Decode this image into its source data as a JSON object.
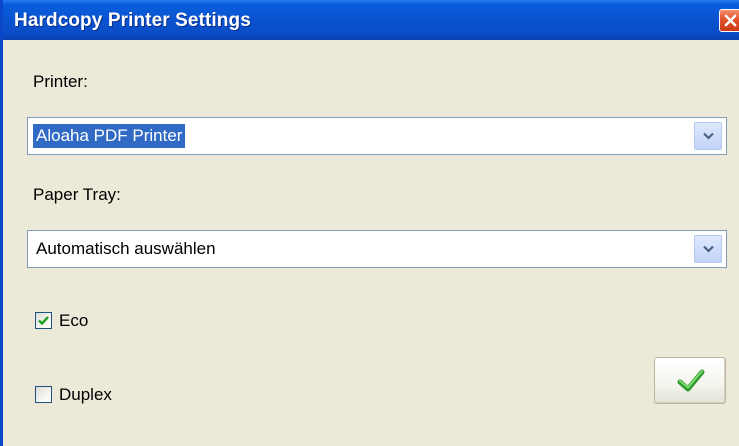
{
  "window": {
    "title": "Hardcopy Printer Settings",
    "close_icon": "close-icon"
  },
  "printer": {
    "label": "Printer:",
    "selected_value": "Aloaha PDF Printer",
    "icon": "chevron-down-icon"
  },
  "paper_tray": {
    "label": "Paper Tray:",
    "selected_value": "Automatisch auswählen",
    "icon": "chevron-down-icon"
  },
  "eco": {
    "label": "Eco",
    "checked": true
  },
  "duplex": {
    "label": "Duplex",
    "checked": false
  },
  "ok_button": {
    "icon": "checkmark-icon"
  },
  "colors": {
    "titlebar": "#0a53d0",
    "dialog_background": "#ece9d8",
    "selection": "#316ac5",
    "close_button": "#e2522c",
    "check_green": "#21a121"
  }
}
